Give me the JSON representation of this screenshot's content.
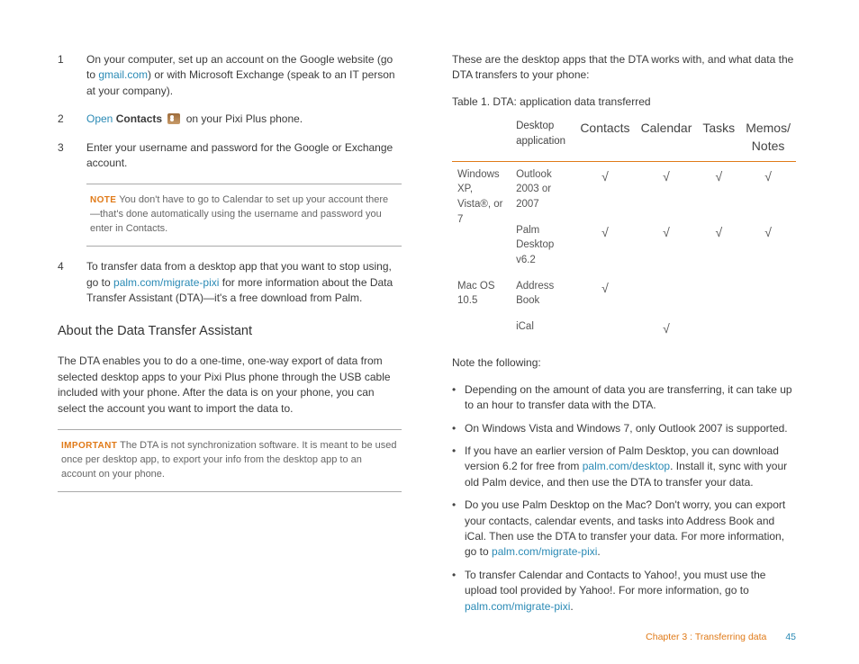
{
  "left": {
    "steps": [
      {
        "num": "1",
        "pre": "On your computer, set up an account on the Google website (go to ",
        "link": "gmail.com",
        "post": ") or with Microsoft Exchange (speak to an IT person at your company)."
      },
      {
        "num": "2",
        "open": "Open",
        "bold": "Contacts",
        "post2": " on your Pixi Plus phone."
      },
      {
        "num": "3",
        "text": "Enter your username and password for the Google or Exchange account."
      }
    ],
    "note": {
      "label": "NOTE",
      "text": "  You don't have to go to Calendar to set up your account there—that's done automatically using the username and password you enter in Contacts."
    },
    "step4": {
      "num": "4",
      "pre": "To transfer data from a desktop app that you want to stop using, go to ",
      "link": "palm.com/migrate-pixi",
      "post": " for more information about the Data Transfer Assistant (DTA)—it's a free download from Palm."
    },
    "h2": "About the Data Transfer Assistant",
    "p1": "The DTA enables you to do a one-time, one-way export of data from selected desktop apps to your Pixi Plus phone through the USB cable included with your phone. After the data is on your phone, you can select the account you want to import the data to.",
    "imp": {
      "label": "IMPORTANT",
      "text": "  The DTA is not synchronization software. It is meant to be used once per desktop app, to export your info from the desktop app to an account on your phone."
    }
  },
  "right": {
    "intro": "These are the desktop apps that the DTA works with, and what data the DTA transfers to your phone:",
    "tablecap": "Table 1.  DTA: application data transferred",
    "headers": [
      "",
      "Desktop application",
      "Contacts",
      "Calendar",
      "Tasks",
      "Memos/\nNotes"
    ],
    "os1": "Windows XP, Vista®, or 7",
    "os2": "Mac OS 10.5",
    "rows": [
      {
        "app": "Outlook 2003 or 2007",
        "c": "√",
        "cal": "√",
        "t": "√",
        "m": "√"
      },
      {
        "app": "Palm Desktop v6.2",
        "c": "√",
        "cal": "√",
        "t": "√",
        "m": "√"
      },
      {
        "app": "Address Book",
        "c": "√",
        "cal": "",
        "t": "",
        "m": ""
      },
      {
        "app": "iCal",
        "c": "",
        "cal": "√",
        "t": "",
        "m": ""
      }
    ],
    "notehdr": "Note the following:",
    "b1": "Depending on the amount of data you are transferring, it can take up to an hour to transfer data with the DTA.",
    "b2": "On Windows Vista and Windows 7, only Outlook 2007 is supported.",
    "b3a": "If you have an earlier version of Palm Desktop, you can download version 6.2 for free from ",
    "b3link": "palm.com/desktop",
    "b3b": ". Install it, sync with your old Palm device, and then use the DTA to transfer your data.",
    "b4a": "Do you use Palm Desktop on the Mac? Don't worry, you can export your contacts, calendar events, and tasks into Address Book and iCal. Then use the DTA to transfer your data. For more information, go to ",
    "b4link": "palm.com/migrate-pixi",
    "b4b": ".",
    "b5a": "To transfer Calendar and Contacts to Yahoo!, you must use the upload tool provided by Yahoo!. For more information, go to ",
    "b5link": "palm.com/migrate-pixi",
    "b5b": "."
  },
  "footer": {
    "chapter": "Chapter 3  :  Transferring data",
    "page": "45"
  }
}
